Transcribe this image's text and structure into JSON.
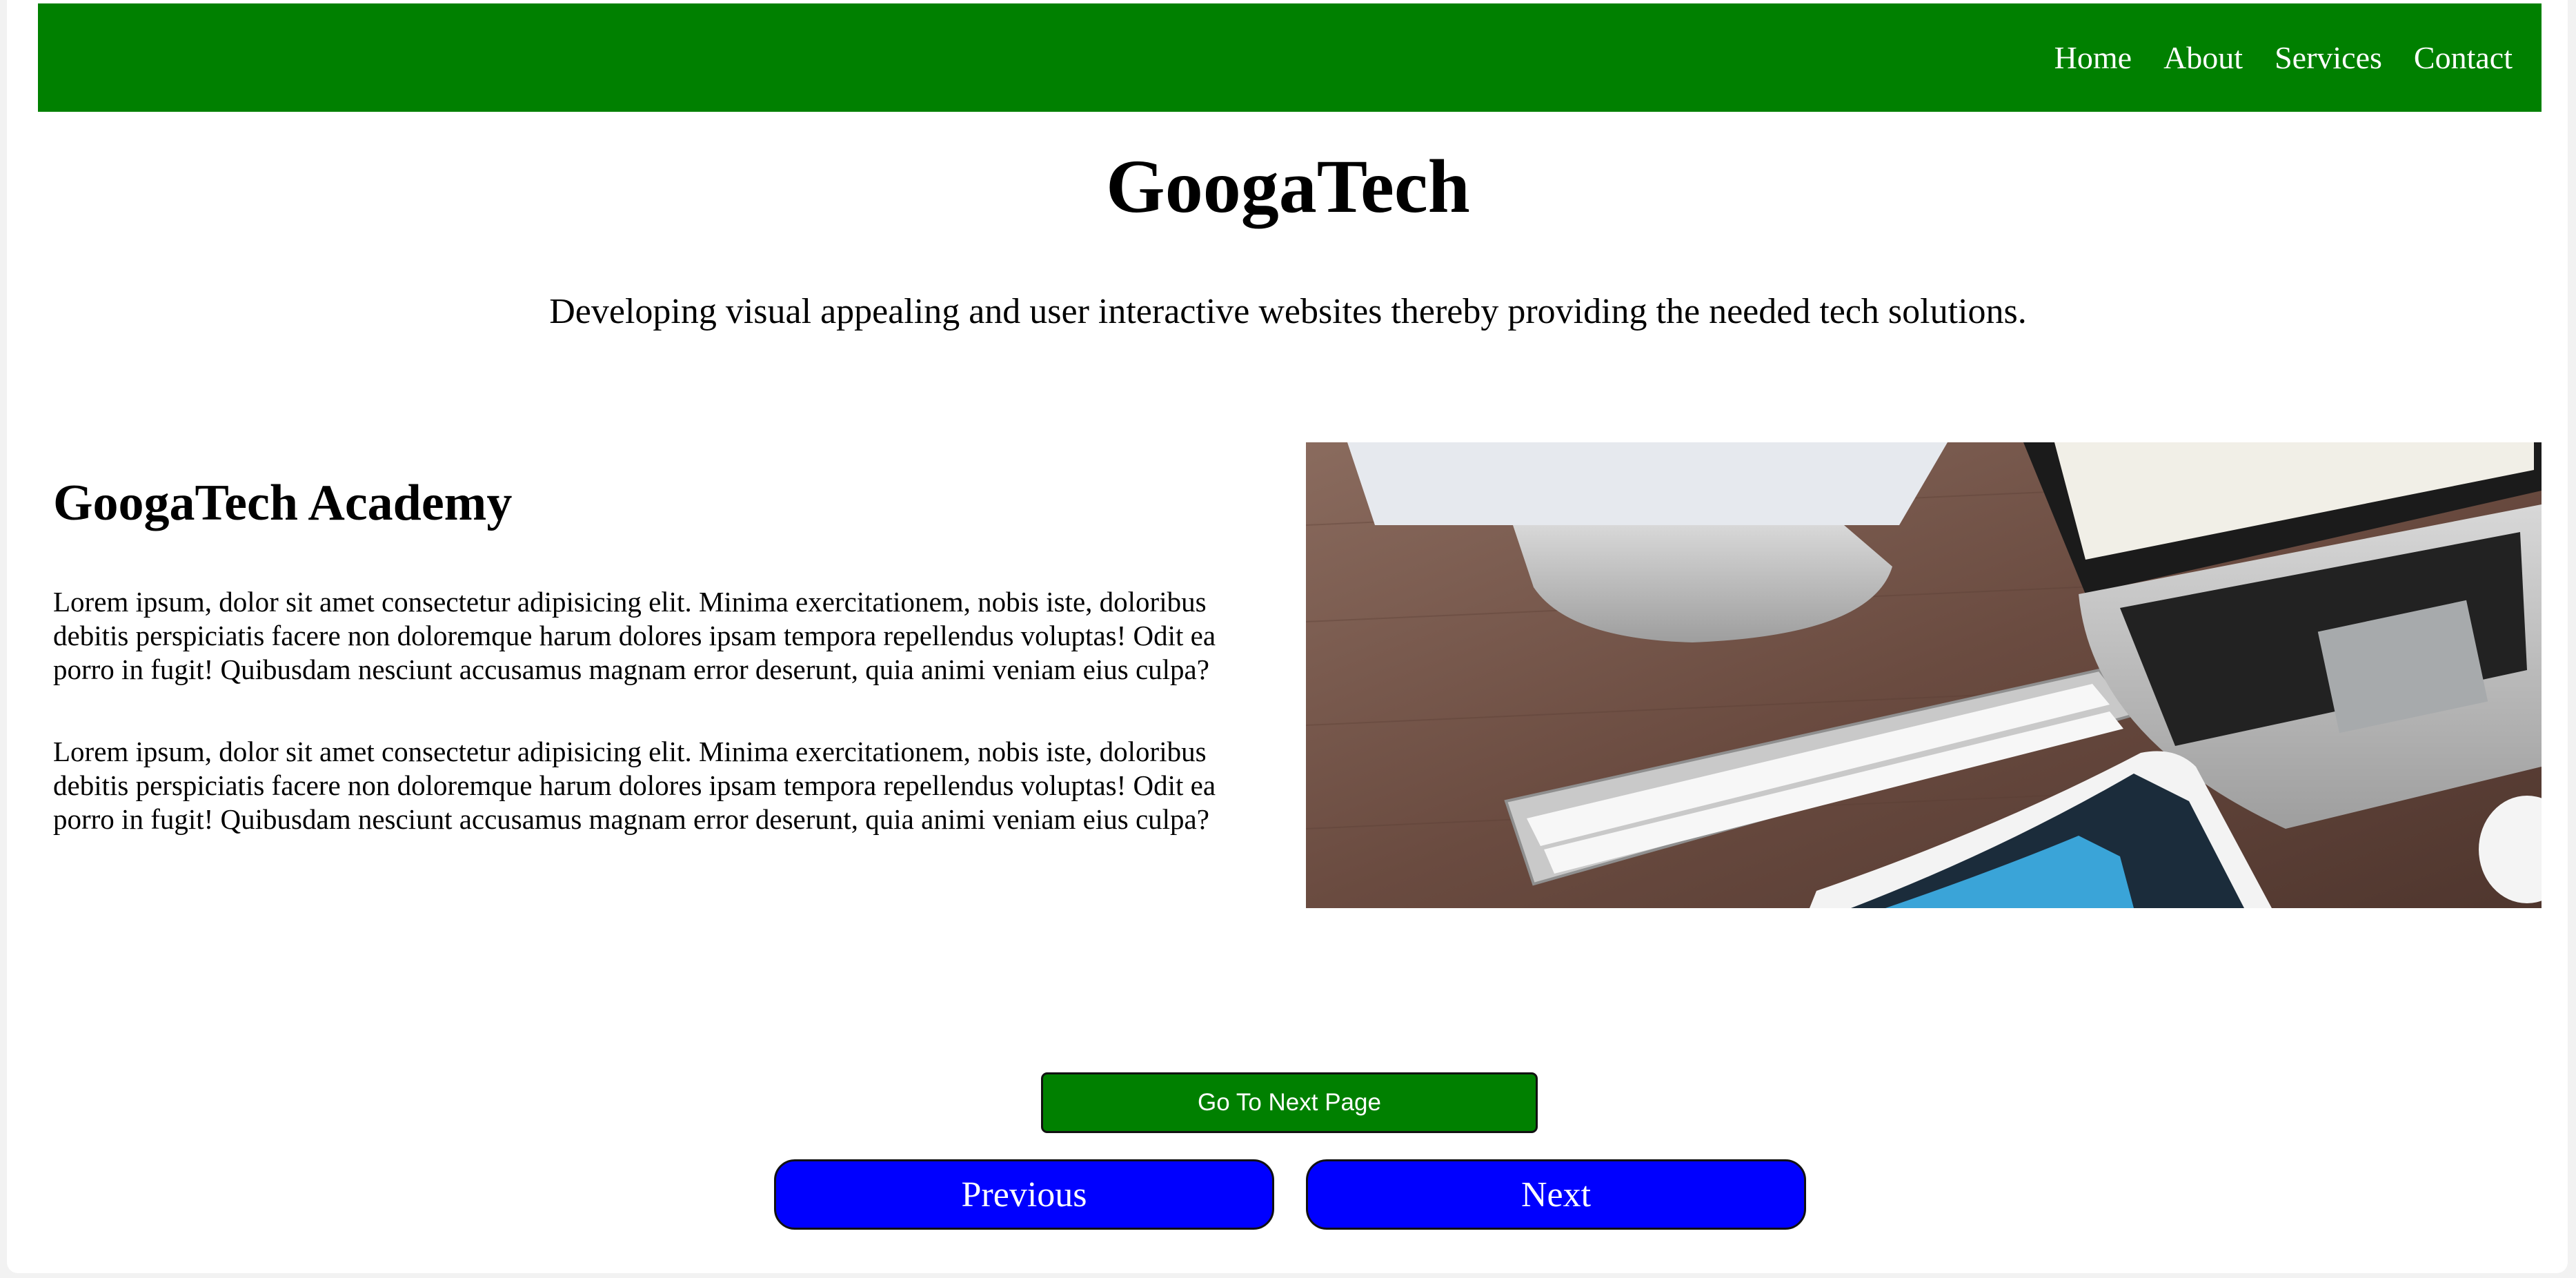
{
  "nav": {
    "links": [
      "Home",
      "About",
      "Services",
      "Contact"
    ]
  },
  "header": {
    "title": "GoogaTech",
    "tagline": "Developing visual appealing and user interactive websites thereby providing the needed tech solutions."
  },
  "academy": {
    "heading": "GoogaTech Academy",
    "paragraphs": [
      "Lorem ipsum, dolor sit amet consectetur adipisicing elit. Minima exercitationem, nobis iste, doloribus debitis perspiciatis facere non doloremque harum dolores ipsam tempora repellendus voluptas! Odit ea porro in fugit! Quibusdam nesciunt accusamus magnam error deserunt, quia animi veniam eius culpa?",
      "Lorem ipsum, dolor sit amet consectetur adipisicing elit. Minima exercitationem, nobis iste, doloribus debitis perspiciatis facere non doloremque harum dolores ipsam tempora repellendus voluptas! Odit ea porro in fugit! Quibusdam nesciunt accusamus magnam error deserunt, quia animi veniam eius culpa?"
    ]
  },
  "hero_image": {
    "icon": "desk-workspace-photo"
  },
  "buttons": {
    "next_page": "Go To Next Page",
    "previous": "Previous",
    "next": "Next"
  },
  "colors": {
    "nav_bg": "#008000",
    "next_page_bg": "#008000",
    "pill_bg": "#0000ff"
  }
}
